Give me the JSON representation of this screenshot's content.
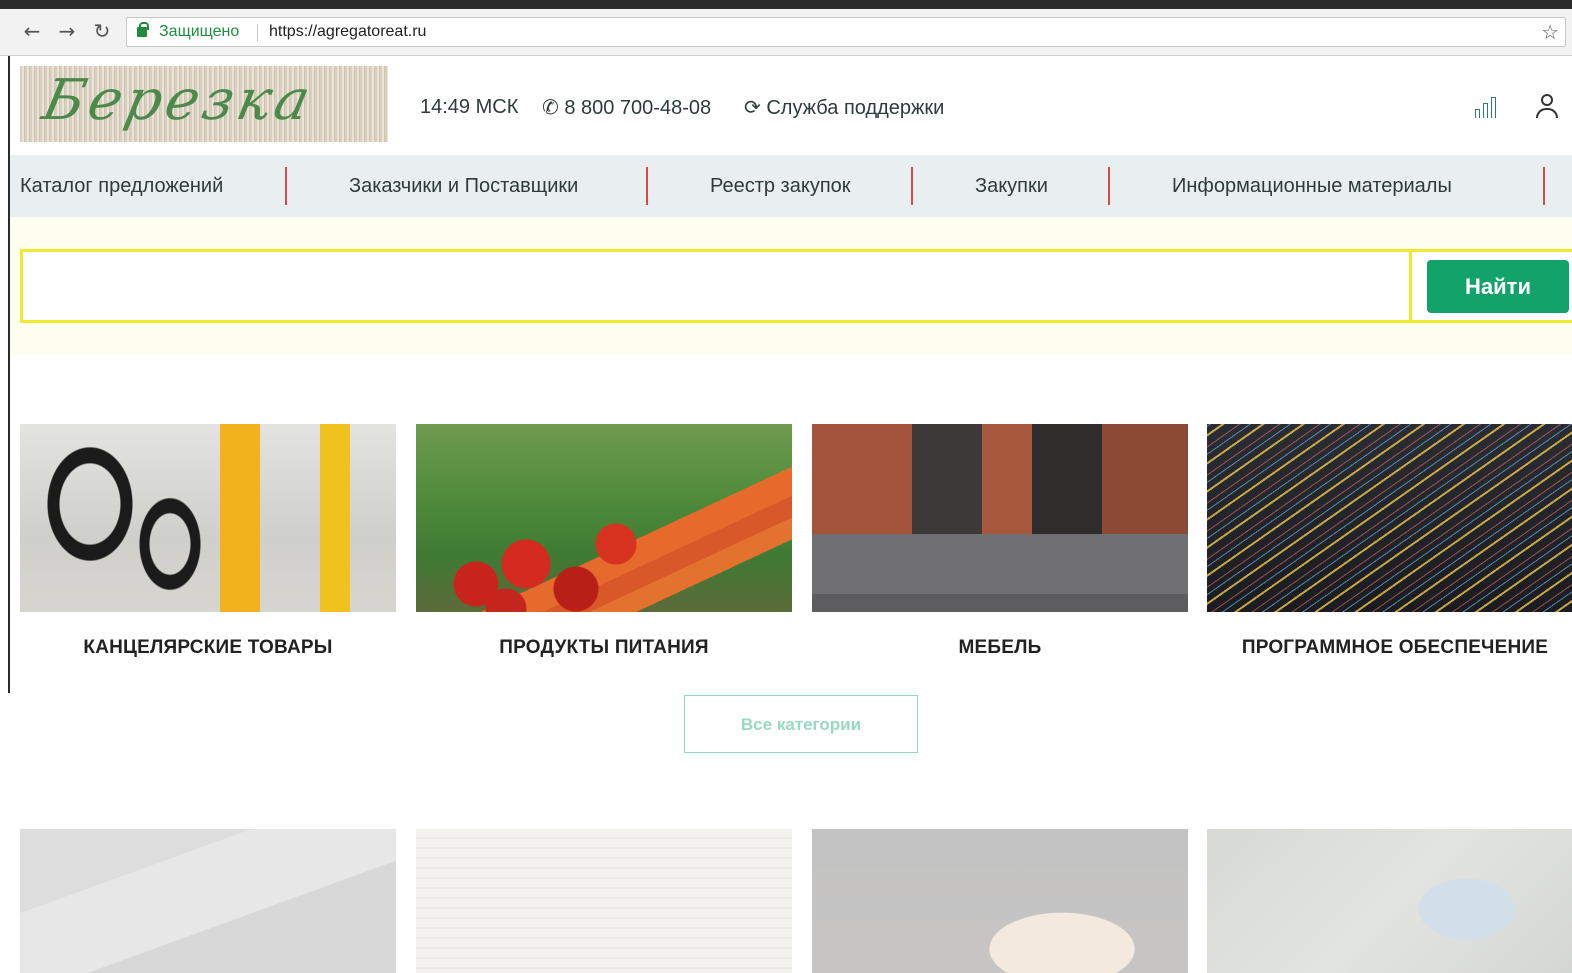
{
  "browser": {
    "secure_label": "Защищено",
    "url": "https://agregatoreat.ru"
  },
  "header": {
    "logo_text": "Березка",
    "time": "14:49 МСК",
    "phone": "8 800 700-48-08",
    "support": "Служба поддержки"
  },
  "nav": {
    "items": [
      {
        "label": "Каталог предложений"
      },
      {
        "label": "Заказчики и Поставщики"
      },
      {
        "label": "Реестр закупок"
      },
      {
        "label": "Закупки"
      },
      {
        "label": "Информационные материалы"
      }
    ],
    "separator_color": "#d64a4a"
  },
  "search": {
    "value": "",
    "button_label": "Найти",
    "accent": "#f2e82e",
    "button_color": "#12a36b"
  },
  "categories": [
    {
      "label": "КАНЦЕЛЯРСКИЕ ТОВАРЫ",
      "image": "stationery"
    },
    {
      "label": "ПРОДУКТЫ ПИТАНИЯ",
      "image": "vegetables"
    },
    {
      "label": "МЕБЕЛЬ",
      "image": "furniture"
    },
    {
      "label": "ПРОГРАММНОЕ ОБЕСПЕЧЕНИЕ",
      "image": "code-screen"
    }
  ],
  "all_categories_label": "Все категории",
  "secondary_tiles": [
    {
      "image": "laptop-cart"
    },
    {
      "image": "books"
    },
    {
      "image": "gavel-book"
    },
    {
      "image": "laptop-people"
    }
  ]
}
